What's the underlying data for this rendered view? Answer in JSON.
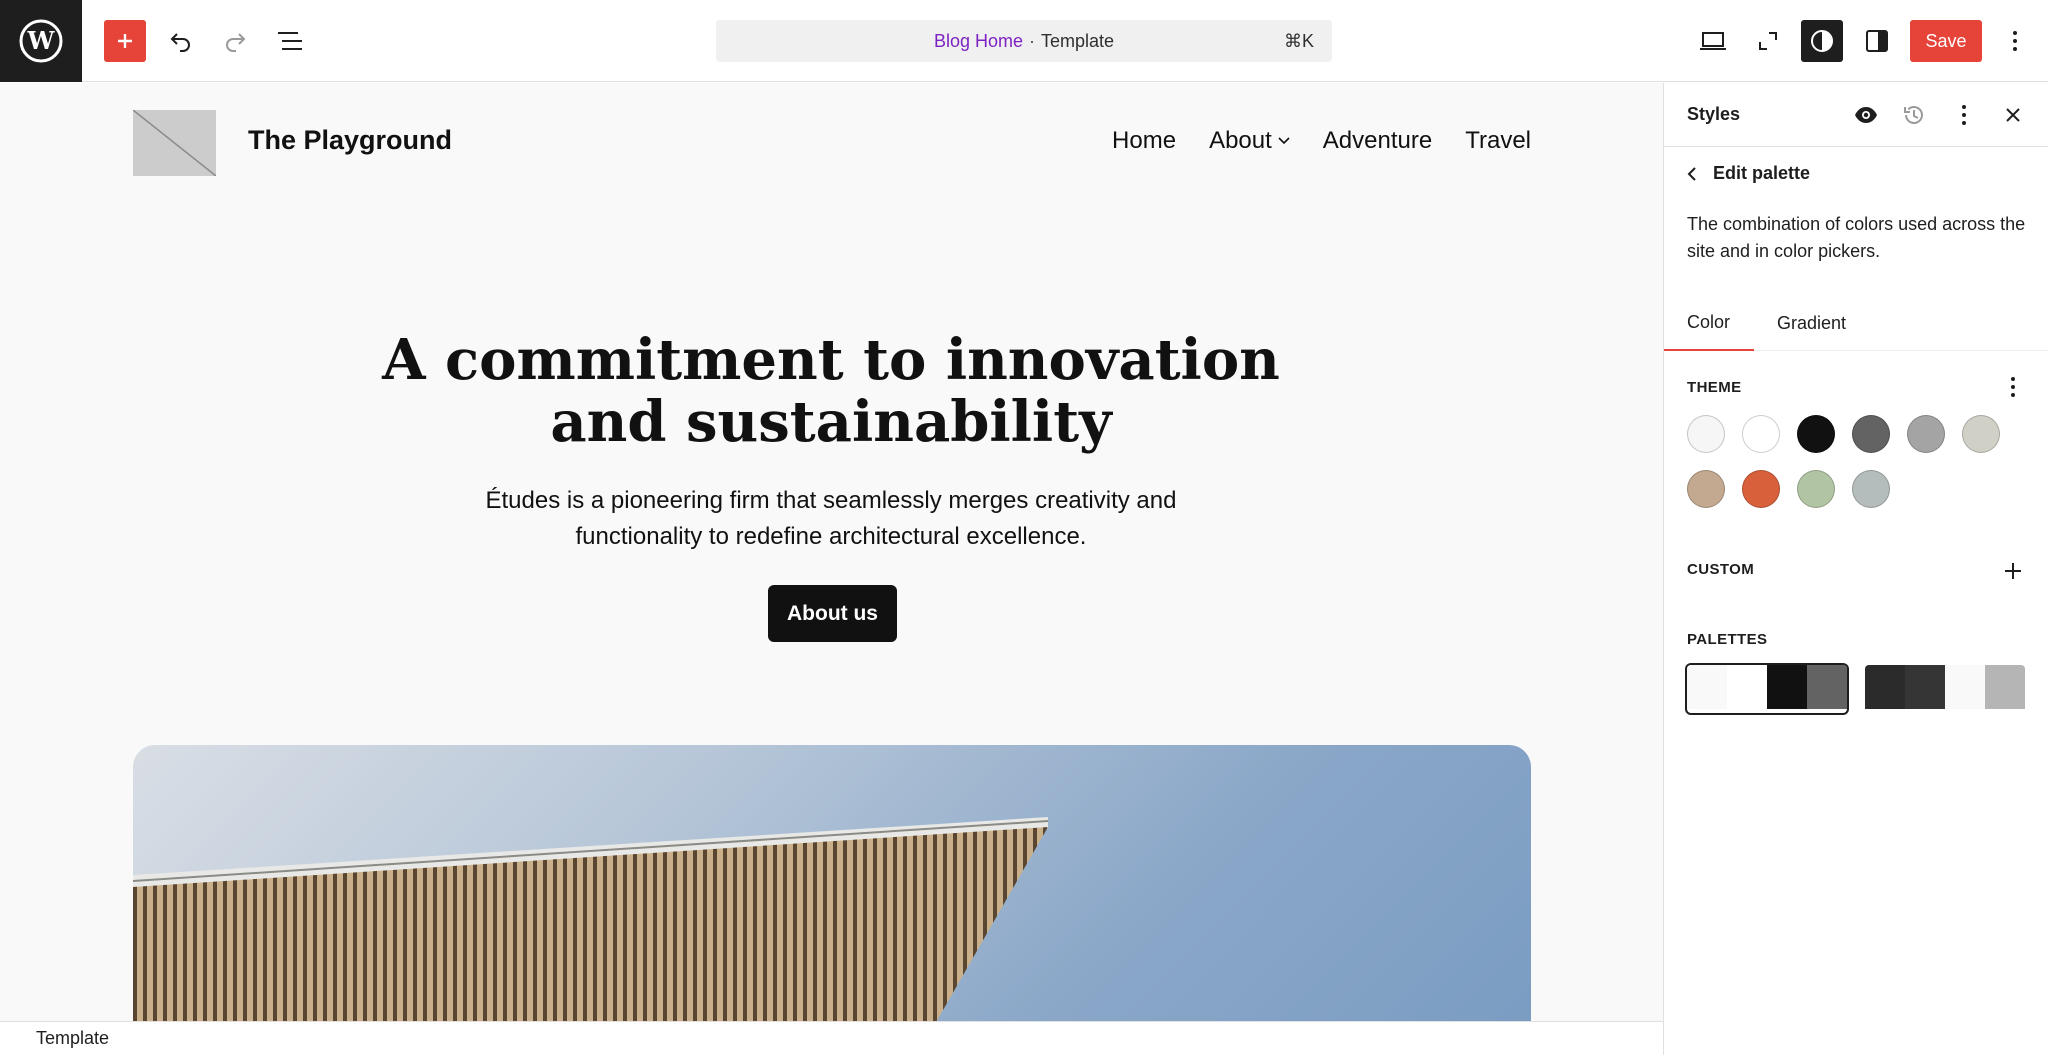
{
  "toolbar": {
    "command_center": {
      "title": "Blog Home",
      "separator": "·",
      "type": "Template",
      "shortcut": "⌘K"
    },
    "save_label": "Save"
  },
  "canvas": {
    "site_title": "The Playground",
    "nav": [
      "Home",
      "About",
      "Adventure",
      "Travel"
    ],
    "hero_title": "A commitment to innovation and sustainability",
    "hero_text": "Études is a pioneering firm that seamlessly merges creativity and functionality to redefine architectural excellence.",
    "about_button": "About us"
  },
  "statusbar": {
    "label": "Template"
  },
  "panel": {
    "title": "Styles",
    "back_label": "Edit palette",
    "description": "The combination of colors used across the site and in color pickers.",
    "tabs": [
      "Color",
      "Gradient"
    ],
    "theme_label": "THEME",
    "custom_label": "CUSTOM",
    "palettes_label": "PALETTES",
    "theme_colors": [
      "#f6f6f6",
      "#ffffff",
      "#111111",
      "#636363",
      "#a4a4a4",
      "#d1d0c7",
      "#c2a990",
      "#d8613c",
      "#b1c5a4",
      "#b5bdbc"
    ],
    "palettes": [
      [
        "#f9f9f9",
        "#ffffff",
        "#111111",
        "#636363"
      ],
      [
        "#2b2b2b",
        "#353535",
        "#f9f9f9",
        "#b5b5b5"
      ]
    ]
  },
  "colors": {
    "accent": "#e64339",
    "admin_dark": "#1e1e1e",
    "link_purple": "#7d22c2"
  },
  "icons": [
    "wordpress-icon",
    "plus-icon",
    "undo-icon",
    "redo-icon",
    "list-view-icon",
    "desktop-icon",
    "zoom-out-icon",
    "styles-icon",
    "sidebar-icon",
    "more-vertical-icon",
    "eye-icon",
    "revisions-icon",
    "close-icon",
    "chevron-left-icon",
    "chevron-down-icon"
  ]
}
